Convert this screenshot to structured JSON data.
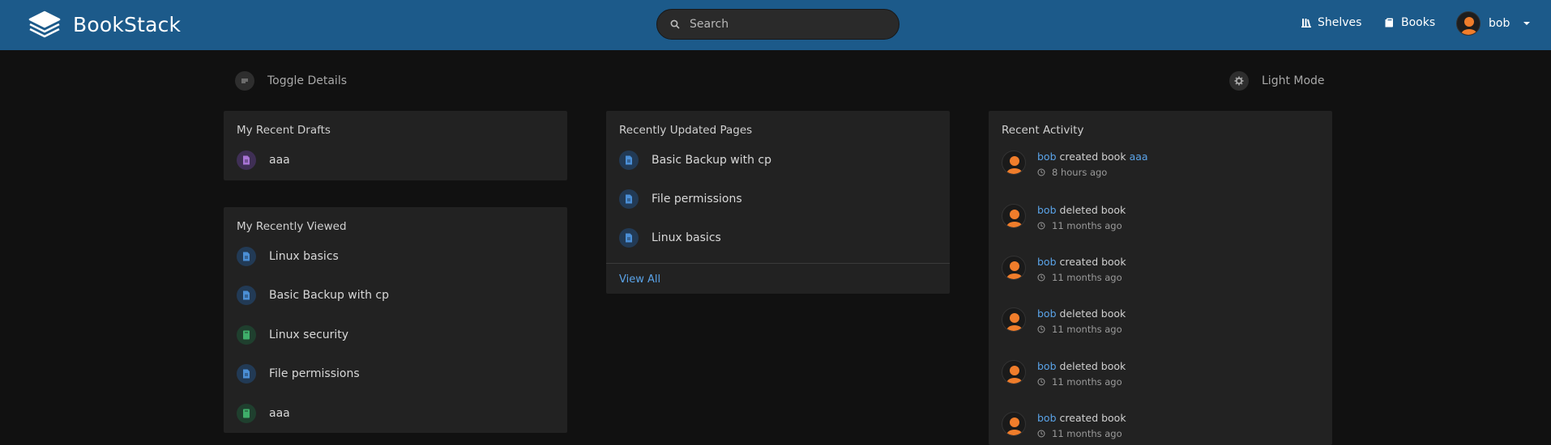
{
  "header": {
    "app_name": "BookStack",
    "search_placeholder": "Search",
    "nav": {
      "shelves": "Shelves",
      "books": "Books"
    },
    "user_name": "bob"
  },
  "toolbar": {
    "toggle_details": "Toggle Details",
    "light_mode": "Light Mode"
  },
  "drafts": {
    "title": "My Recent Drafts",
    "items": [
      {
        "label": "aaa",
        "icon": "draft-icon"
      }
    ]
  },
  "viewed": {
    "title": "My Recently Viewed",
    "items": [
      {
        "label": "Linux basics",
        "icon": "page-icon"
      },
      {
        "label": "Basic Backup with cp",
        "icon": "page-icon"
      },
      {
        "label": "Linux security",
        "icon": "book-icon"
      },
      {
        "label": "File permissions",
        "icon": "page-icon"
      },
      {
        "label": "aaa",
        "icon": "book-icon"
      }
    ]
  },
  "updated": {
    "title": "Recently Updated Pages",
    "items": [
      {
        "label": "Basic Backup with cp",
        "icon": "page-icon"
      },
      {
        "label": "File permissions",
        "icon": "page-icon"
      },
      {
        "label": "Linux basics",
        "icon": "page-icon"
      }
    ],
    "view_all": "View All"
  },
  "activity": {
    "title": "Recent Activity",
    "items": [
      {
        "user": "bob",
        "action": "created book",
        "target": "aaa",
        "time": "8 hours ago"
      },
      {
        "user": "bob",
        "action": "deleted book",
        "target": "",
        "time": "11 months ago"
      },
      {
        "user": "bob",
        "action": "created book",
        "target": "",
        "time": "11 months ago"
      },
      {
        "user": "bob",
        "action": "deleted book",
        "target": "",
        "time": "11 months ago"
      },
      {
        "user": "bob",
        "action": "deleted book",
        "target": "",
        "time": "11 months ago"
      },
      {
        "user": "bob",
        "action": "created book",
        "target": "",
        "time": "11 months ago"
      }
    ]
  },
  "colors": {
    "header": "#1c5a8a",
    "background": "#111111",
    "card": "#222222",
    "link": "#5aa3e8",
    "draft": "#a974d6",
    "page": "#4b8fd6",
    "book": "#3fae6a"
  }
}
